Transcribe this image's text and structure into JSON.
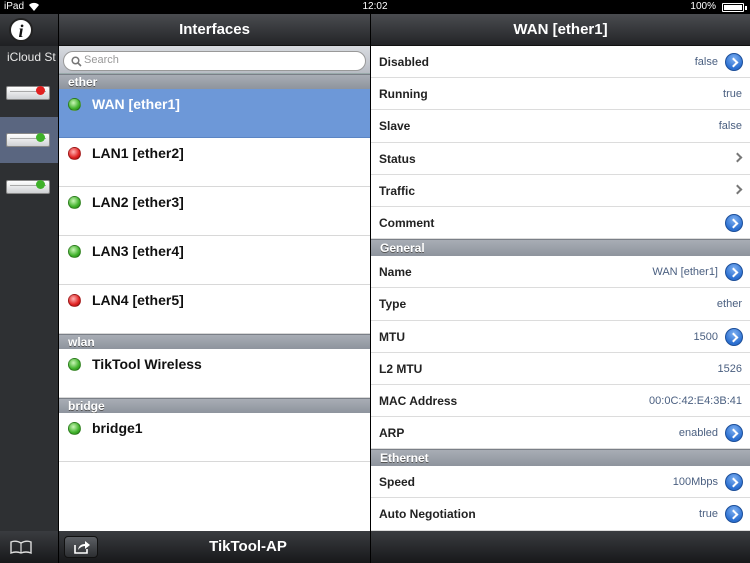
{
  "status_bar": {
    "carrier": "iPad",
    "time": "12:02",
    "battery": "100%"
  },
  "left_strip": {
    "icloud_label": "iCloud St",
    "routers": [
      {
        "led": "red",
        "selected": false
      },
      {
        "led": "green",
        "selected": true
      },
      {
        "led": "green",
        "selected": false
      }
    ]
  },
  "interfaces": {
    "title": "Interfaces",
    "search_placeholder": "Search",
    "sections": [
      {
        "name": "ether",
        "items": [
          {
            "label": "WAN [ether1]",
            "status": "green",
            "selected": true
          },
          {
            "label": "LAN1 [ether2]",
            "status": "red",
            "selected": false
          },
          {
            "label": "LAN2 [ether3]",
            "status": "green",
            "selected": false
          },
          {
            "label": "LAN3 [ether4]",
            "status": "green",
            "selected": false
          },
          {
            "label": "LAN4 [ether5]",
            "status": "red",
            "selected": false
          }
        ]
      },
      {
        "name": "wlan",
        "items": [
          {
            "label": "TikTool Wireless",
            "status": "green",
            "selected": false
          }
        ]
      },
      {
        "name": "bridge",
        "items": [
          {
            "label": "bridge1",
            "status": "green",
            "selected": false
          }
        ]
      }
    ]
  },
  "detail": {
    "title": "WAN [ether1]",
    "rows_top": [
      {
        "key": "Disabled",
        "value": "false",
        "accessory": "disclosure"
      },
      {
        "key": "Running",
        "value": "true",
        "accessory": "none"
      },
      {
        "key": "Slave",
        "value": "false",
        "accessory": "none"
      },
      {
        "key": "Status",
        "value": "",
        "accessory": "chevron"
      },
      {
        "key": "Traffic",
        "value": "",
        "accessory": "chevron"
      },
      {
        "key": "Comment",
        "value": "",
        "accessory": "disclosure"
      }
    ],
    "general_header": "General",
    "rows_general": [
      {
        "key": "Name",
        "value": "WAN [ether1]",
        "accessory": "disclosure"
      },
      {
        "key": "Type",
        "value": "ether",
        "accessory": "none"
      },
      {
        "key": "MTU",
        "value": "1500",
        "accessory": "disclosure"
      },
      {
        "key": "L2 MTU",
        "value": "1526",
        "accessory": "none"
      },
      {
        "key": "MAC Address",
        "value": "00:0C:42:E4:3B:41",
        "accessory": "none"
      },
      {
        "key": "ARP",
        "value": "enabled",
        "accessory": "disclosure"
      }
    ],
    "ethernet_header": "Ethernet",
    "rows_ethernet": [
      {
        "key": "Speed",
        "value": "100Mbps",
        "accessory": "disclosure"
      },
      {
        "key": "Auto Negotiation",
        "value": "true",
        "accessory": "disclosure"
      }
    ]
  },
  "bottom_bar": {
    "title": "TikTool-AP"
  },
  "colors": {
    "selection": "#6d98d8",
    "accent": "#2b6fd0",
    "led_green": "#3fb12a",
    "led_red": "#e02020"
  }
}
